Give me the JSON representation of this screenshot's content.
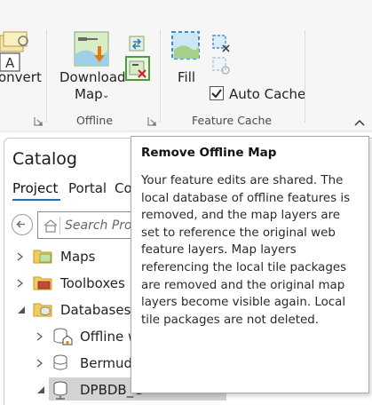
{
  "ribbon": {
    "convert": {
      "label": "onvert"
    },
    "download_map": {
      "label_line1": "Download",
      "label_line2": "Map"
    },
    "fill": {
      "label": "Fill"
    },
    "auto_cache": {
      "label": "Auto Cache",
      "checked": true
    },
    "groups": {
      "offline": "Offline",
      "feature_cache": "Feature Cache"
    }
  },
  "catalog": {
    "title": "Catalog",
    "tabs": [
      "Project",
      "Portal",
      "Co"
    ],
    "search": {
      "placeholder": "Search Proje"
    },
    "tree": [
      {
        "label": "Maps",
        "icon": "folder-map-icon"
      },
      {
        "label": "Toolboxes",
        "icon": "toolbox-icon"
      },
      {
        "label": "Databases",
        "icon": "database-folder-icon"
      },
      {
        "label": "Offline w",
        "icon": "database-home-icon"
      },
      {
        "label": "Bermuda",
        "icon": "database-icon"
      },
      {
        "label": "DPBDB_C",
        "icon": "database-server-icon"
      }
    ]
  },
  "tooltip": {
    "title": "Remove Offline Map",
    "body": "Your feature edits are shared. The local database of offline features is removed, and the map layers are set to reference the original web feature layers. Map layers referencing the local tile packages are removed and the original map layers become visible again. Local tile packages are not deleted."
  },
  "colors": {
    "accent": "#1f6fb4",
    "selection": "#d3d3d3",
    "tooltip_border": "#a8a8a8"
  }
}
